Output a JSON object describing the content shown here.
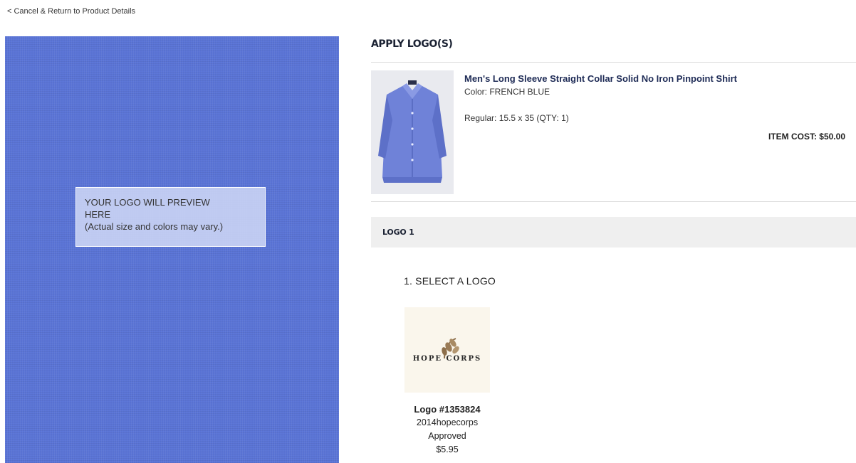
{
  "nav": {
    "back_label": "< Cancel & Return to Product Details"
  },
  "preview": {
    "line1": "YOUR LOGO WILL PREVIEW",
    "line2": "HERE",
    "line3": "(Actual size and colors may vary.)",
    "fabric_color": "#5a74d6"
  },
  "page": {
    "heading": "APPLY LOGO(S)"
  },
  "product": {
    "name": "Men's Long Sleeve Straight Collar Solid No Iron Pinpoint Shirt",
    "color": "Color: FRENCH BLUE",
    "size": "Regular: 15.5 x 35 (QTY: 1)",
    "item_cost": "ITEM COST: $50.00",
    "thumbnail_icon": "shirt-icon"
  },
  "logo_section": {
    "title": "LOGO 1",
    "step_title": "1. SELECT A LOGO",
    "logos": [
      {
        "art_text": "HOPE CORPS",
        "number": "Logo #1353824",
        "name": "2014hopecorps",
        "status": "Approved",
        "price": "$5.95"
      }
    ]
  }
}
